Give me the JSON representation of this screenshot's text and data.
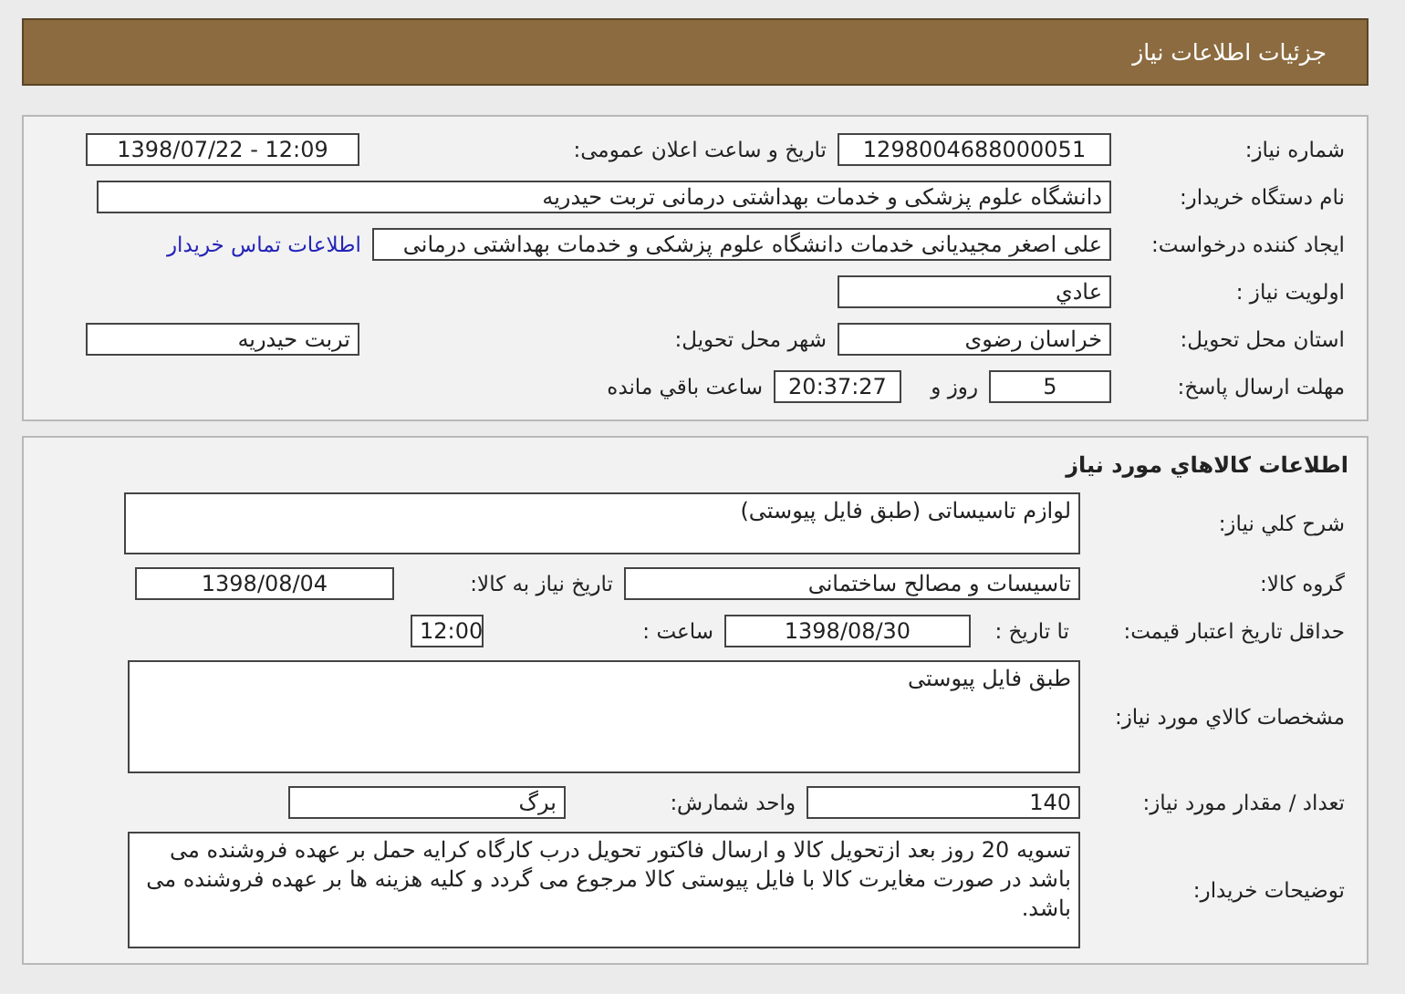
{
  "header": {
    "title": "جزئیات اطلاعات نیاز"
  },
  "need": {
    "number_label": "شماره نیاز:",
    "number": "1298004688000051",
    "announce_label": "تاریخ و ساعت اعلان عمومی:",
    "announce": "1398/07/22 - 12:09",
    "buyer_label": "نام دستگاه خریدار:",
    "buyer": "دانشگاه علوم پزشکی و خدمات بهداشتی درمانی تربت حیدریه",
    "creator_label": "ایجاد کننده درخواست:",
    "creator": "علی اصغر مجیدیانی خدمات دانشگاه علوم پزشکی و خدمات بهداشتی درمانی",
    "contact_link": "اطلاعات تماس خریدار",
    "priority_label": "اولویت نیاز :",
    "priority": "عادي",
    "province_label": "استان محل تحویل:",
    "province": "خراسان رضوی",
    "city_label": "شهر محل تحویل:",
    "city": "تربت حیدریه",
    "deadline_label": "مهلت ارسال پاسخ:",
    "days": "5",
    "days_label": "روز و",
    "time": "20:37:27",
    "time_label": "ساعت باقي مانده"
  },
  "goods": {
    "title": "اطلاعات كالاهاي مورد نياز",
    "summary_label": "شرح كلي نياز:",
    "summary": "لوازم تاسیساتی (طبق فایل پیوستی)",
    "group_label": "گروه کالا:",
    "group": "تاسیسات و مصالح ساختمانی",
    "need_date_label": "تاریخ نیاز به کالا:",
    "need_date": "1398/08/04",
    "validity_label": "حداقل تاریخ اعتبار قیمت:",
    "until_label": "تا تاریخ :",
    "until_date": "1398/08/30",
    "hour_label": "ساعت :",
    "hour": "12:00",
    "spec_label": "مشخصات كالاي مورد نياز:",
    "spec": "طبق فایل پیوستی",
    "qty_label": "تعداد / مقدار مورد نیاز:",
    "qty": "140",
    "unit_label": "واحد شمارش:",
    "unit": "برگ",
    "notes_label": "توضیحات خریدار:",
    "notes": "تسویه 20 روز بعد ازتحویل کالا و ارسال فاکتور تحویل درب کارگاه کرایه حمل بر عهده فروشنده می باشد در صورت مغایرت کالا با فایل پیوستی کالا مرجوع می گردد و کلیه هزینه ها بر عهده فروشنده می باشد."
  }
}
